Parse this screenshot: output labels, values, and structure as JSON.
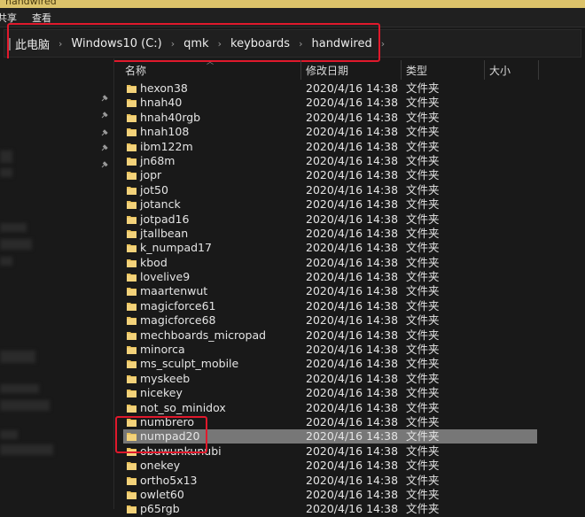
{
  "window": {
    "title": "handwired"
  },
  "menubar": {
    "items": [
      "共享",
      "查看"
    ]
  },
  "address": {
    "crumbs": [
      "此电脑",
      "Windows10 (C:)",
      "qmk",
      "keyboards",
      "handwired"
    ],
    "separator": "›"
  },
  "columns": {
    "name": "名称",
    "modified": "修改日期",
    "type": "类型",
    "size": "大小"
  },
  "rows": [
    {
      "name": "hexon38",
      "date": "2020/4/16 14:38",
      "type": "文件夹"
    },
    {
      "name": "hnah40",
      "date": "2020/4/16 14:38",
      "type": "文件夹"
    },
    {
      "name": "hnah40rgb",
      "date": "2020/4/16 14:38",
      "type": "文件夹"
    },
    {
      "name": "hnah108",
      "date": "2020/4/16 14:38",
      "type": "文件夹"
    },
    {
      "name": "ibm122m",
      "date": "2020/4/16 14:38",
      "type": "文件夹"
    },
    {
      "name": "jn68m",
      "date": "2020/4/16 14:38",
      "type": "文件夹"
    },
    {
      "name": "jopr",
      "date": "2020/4/16 14:38",
      "type": "文件夹"
    },
    {
      "name": "jot50",
      "date": "2020/4/16 14:38",
      "type": "文件夹"
    },
    {
      "name": "jotanck",
      "date": "2020/4/16 14:38",
      "type": "文件夹"
    },
    {
      "name": "jotpad16",
      "date": "2020/4/16 14:38",
      "type": "文件夹"
    },
    {
      "name": "jtallbean",
      "date": "2020/4/16 14:38",
      "type": "文件夹"
    },
    {
      "name": "k_numpad17",
      "date": "2020/4/16 14:38",
      "type": "文件夹"
    },
    {
      "name": "kbod",
      "date": "2020/4/16 14:38",
      "type": "文件夹"
    },
    {
      "name": "lovelive9",
      "date": "2020/4/16 14:38",
      "type": "文件夹"
    },
    {
      "name": "maartenwut",
      "date": "2020/4/16 14:38",
      "type": "文件夹"
    },
    {
      "name": "magicforce61",
      "date": "2020/4/16 14:38",
      "type": "文件夹"
    },
    {
      "name": "magicforce68",
      "date": "2020/4/16 14:38",
      "type": "文件夹"
    },
    {
      "name": "mechboards_micropad",
      "date": "2020/4/16 14:38",
      "type": "文件夹"
    },
    {
      "name": "minorca",
      "date": "2020/4/16 14:38",
      "type": "文件夹"
    },
    {
      "name": "ms_sculpt_mobile",
      "date": "2020/4/16 14:38",
      "type": "文件夹"
    },
    {
      "name": "myskeeb",
      "date": "2020/4/16 14:38",
      "type": "文件夹"
    },
    {
      "name": "nicekey",
      "date": "2020/4/16 14:38",
      "type": "文件夹"
    },
    {
      "name": "not_so_minidox",
      "date": "2020/4/16 14:38",
      "type": "文件夹"
    },
    {
      "name": "numbrero",
      "date": "2020/4/16 14:38",
      "type": "文件夹"
    },
    {
      "name": "numpad20",
      "date": "2020/4/16 14:38",
      "type": "文件夹",
      "selected": true
    },
    {
      "name": "obuwunkunubi",
      "date": "2020/4/16 14:38",
      "type": "文件夹"
    },
    {
      "name": "onekey",
      "date": "2020/4/16 14:38",
      "type": "文件夹"
    },
    {
      "name": "ortho5x13",
      "date": "2020/4/16 14:38",
      "type": "文件夹"
    },
    {
      "name": "owlet60",
      "date": "2020/4/16 14:38",
      "type": "文件夹"
    },
    {
      "name": "p65rgb",
      "date": "2020/4/16 14:38",
      "type": "文件夹"
    }
  ],
  "colors": {
    "folder": "#e8c15a",
    "annotation": "#e0192c",
    "selection": "#777777",
    "background": "#191919"
  }
}
